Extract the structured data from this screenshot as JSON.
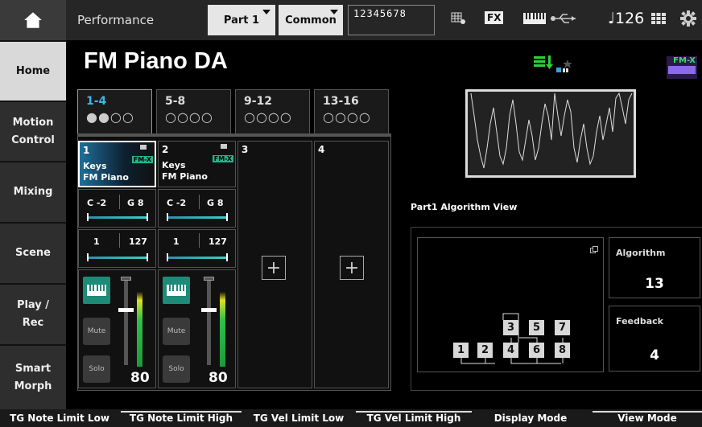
{
  "topbar": {
    "screen_label": "Performance",
    "part_selector": "Part 1",
    "common_selector": "Common",
    "part_numbers": "12345678",
    "fx_label": "FX",
    "tempo": "♩126",
    "icons": [
      "home-icon",
      "effect-grid-icon",
      "keyboard-icon",
      "usb-icon",
      "quick-access-icon",
      "settings-icon"
    ]
  },
  "sidebar": {
    "items": [
      {
        "label": "Home"
      },
      {
        "label": "Motion Control"
      },
      {
        "label": "Mixing"
      },
      {
        "label": "Scene"
      },
      {
        "label": "Play / Rec"
      },
      {
        "label": "Smart Morph"
      }
    ]
  },
  "main": {
    "performance_name": "FM Piano DA",
    "fmx_badge": "FM-X",
    "tabs": [
      {
        "label": "1-4",
        "dots": "●●○○"
      },
      {
        "label": "5-8",
        "dots": "○○○○"
      },
      {
        "label": "9-12",
        "dots": "○○○○"
      },
      {
        "label": "13-16",
        "dots": "○○○○"
      }
    ],
    "parts": [
      {
        "num": "1",
        "category": "Keys",
        "name": "FM Piano",
        "fmx": "FM-X",
        "note_low": "C -2",
        "note_high": "G 8",
        "vel_low": "1",
        "vel_high": "127",
        "mute": "Mute",
        "solo": "Solo",
        "volume": "80"
      },
      {
        "num": "2",
        "category": "Keys",
        "name": "FM Piano",
        "fmx": "FM-X",
        "note_low": "C -2",
        "note_high": "G 8",
        "vel_low": "1",
        "vel_high": "127",
        "mute": "Mute",
        "solo": "Solo",
        "volume": "80"
      },
      {
        "num": "3"
      },
      {
        "num": "4"
      }
    ]
  },
  "right_panel": {
    "algo_title": "Part1 Algorithm View",
    "algorithm_label": "Algorithm",
    "algorithm_value": "13",
    "feedback_label": "Feedback",
    "feedback_value": "4",
    "operators": [
      "1",
      "2",
      "3",
      "4",
      "5",
      "6",
      "7",
      "8"
    ]
  },
  "bottom": {
    "buttons": [
      "TG Note Limit Low",
      "TG Note Limit High",
      "TG Vel Limit Low",
      "TG Vel Limit High",
      "Display Mode",
      "View Mode"
    ]
  }
}
